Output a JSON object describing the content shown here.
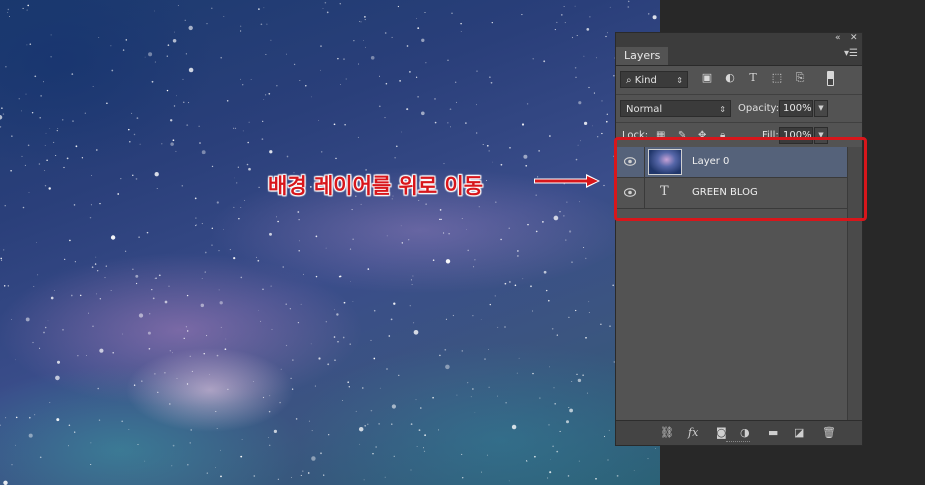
{
  "annotation": {
    "text": "배경 레이어를 위로 이동",
    "color": "#d8161b"
  },
  "panel": {
    "tab_label": "Layers",
    "collapse_icon": "double-chevron-icon",
    "close_icon": "close-icon",
    "menu_icon": "panel-menu-icon",
    "filter": {
      "kind_label": "Kind",
      "icons": [
        "image-filter-icon",
        "adjustment-filter-icon",
        "type-filter-icon",
        "shape-filter-icon",
        "smart-object-filter-icon"
      ]
    },
    "blend_mode": "Normal",
    "opacity_label": "Opacity:",
    "opacity_value": "100%",
    "lock_label": "Lock:",
    "fill_label": "Fill:",
    "fill_value": "100%",
    "layers": [
      {
        "name": "Layer 0",
        "type": "image",
        "selected": true,
        "visible": true
      },
      {
        "name": "GREEN BLOG",
        "type": "text",
        "selected": false,
        "visible": true
      }
    ],
    "bottom_icons": [
      "link-icon",
      "fx-icon",
      "mask-icon",
      "adjustment-icon",
      "folder-icon",
      "new-layer-icon",
      "trash-icon"
    ],
    "selected_color": "#55627a"
  }
}
